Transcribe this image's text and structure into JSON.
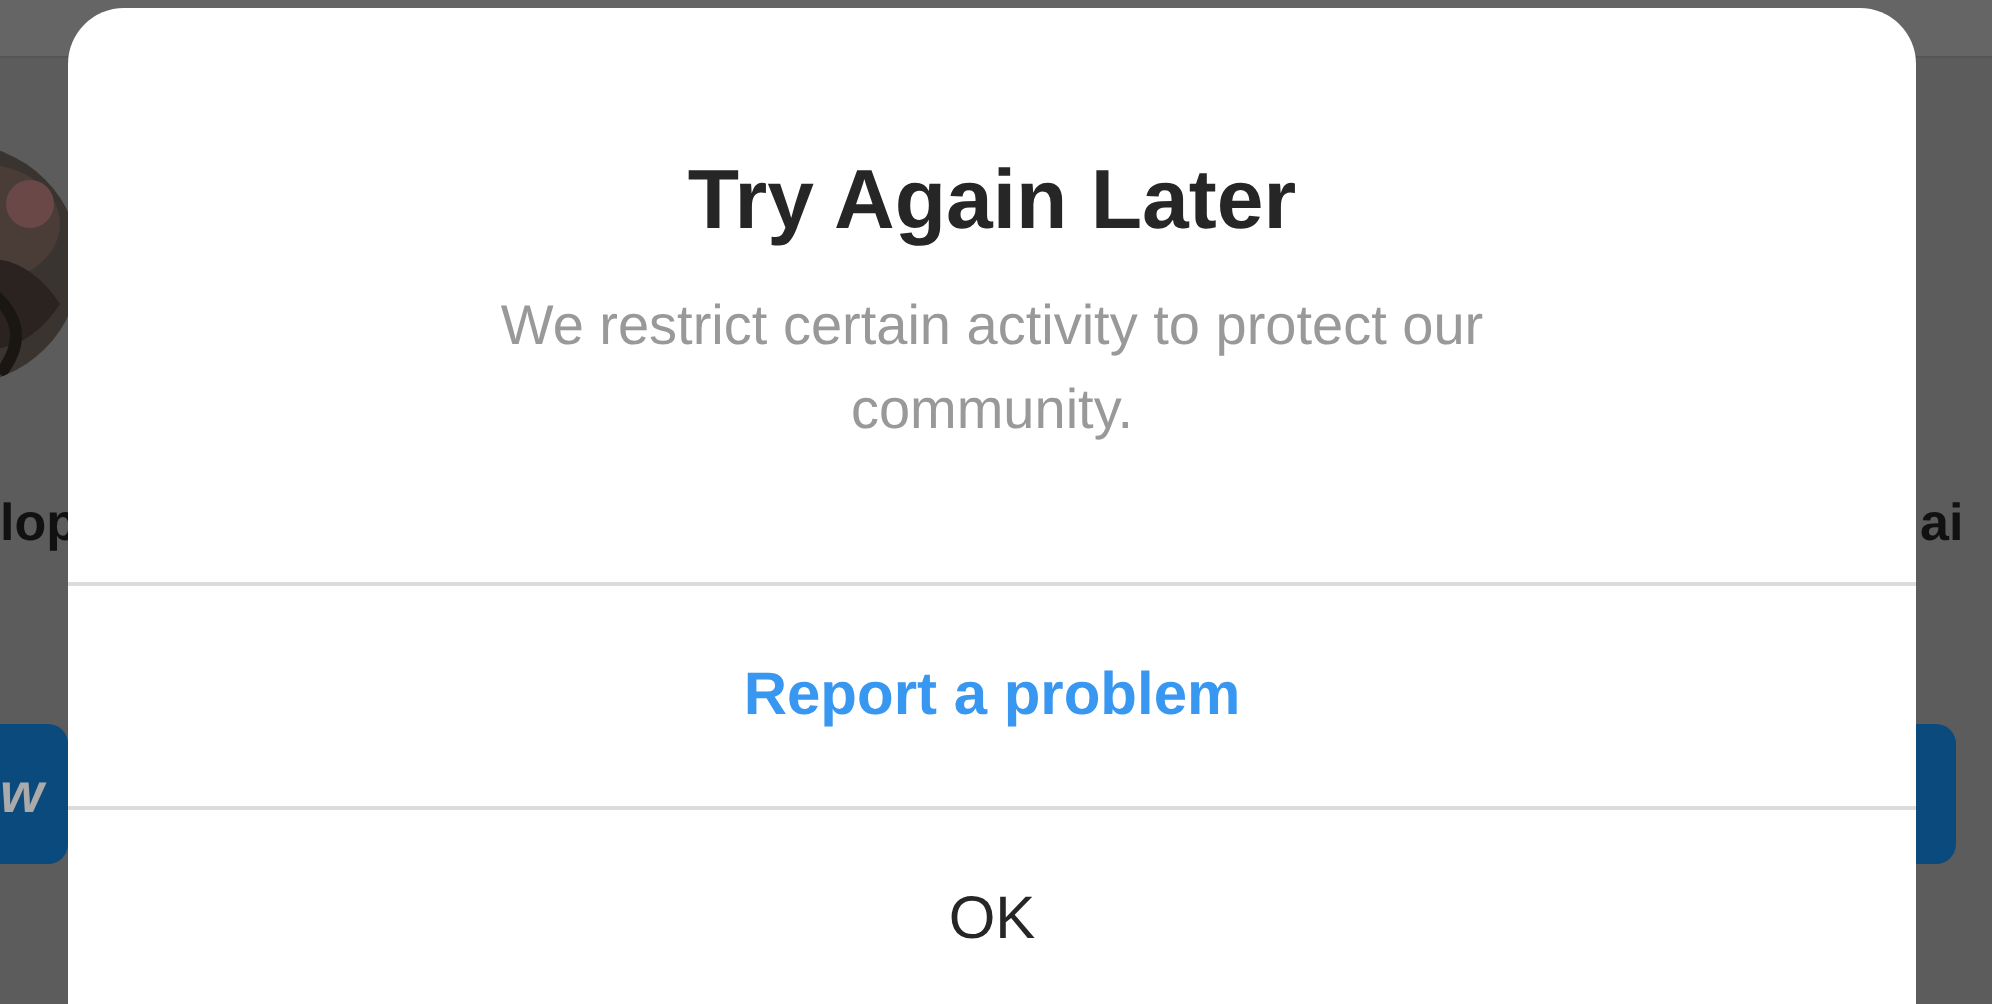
{
  "background": {
    "name_left": "lop",
    "name_right": "ai",
    "button_left": "w"
  },
  "dialog": {
    "title": "Try Again Later",
    "message": "We restrict certain activity to protect our community.",
    "actions": [
      {
        "label": "Report a problem",
        "kind": "primary"
      },
      {
        "label": "OK",
        "kind": "default"
      }
    ]
  }
}
